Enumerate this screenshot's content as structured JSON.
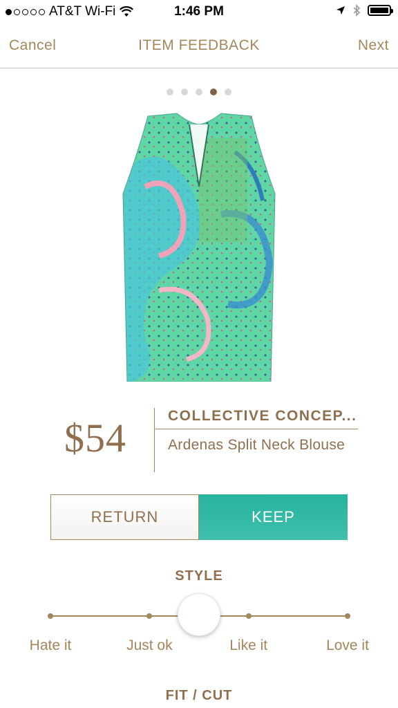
{
  "status_bar": {
    "carrier": "AT&T Wi-Fi",
    "time": "1:46 PM",
    "signal_bars_filled": 1,
    "signal_bars_total": 5,
    "icons": [
      "wifi-icon",
      "location-arrow-icon",
      "bluetooth-icon",
      "battery-icon"
    ]
  },
  "nav": {
    "cancel_label": "Cancel",
    "title": "ITEM FEEDBACK",
    "next_label": "Next"
  },
  "pagination": {
    "total": 5,
    "current": 4
  },
  "product": {
    "image": "sleeveless-split-neck-blouse-green-paisley",
    "price": "$54",
    "brand": "COLLECTIVE CONCEP...",
    "name": "Ardenas Split Neck Blouse"
  },
  "actions": {
    "return_label": "RETURN",
    "keep_label": "KEEP"
  },
  "style_section": {
    "title": "STYLE",
    "options": [
      "Hate it",
      "Just ok",
      "Like it",
      "Love it"
    ],
    "selected_value": 2.5
  },
  "fit_section": {
    "title": "FIT / CUT"
  },
  "colors": {
    "accent_brown": "#a4865b",
    "keep_green": "#2bb5a1",
    "active_dot": "#7e6548"
  }
}
